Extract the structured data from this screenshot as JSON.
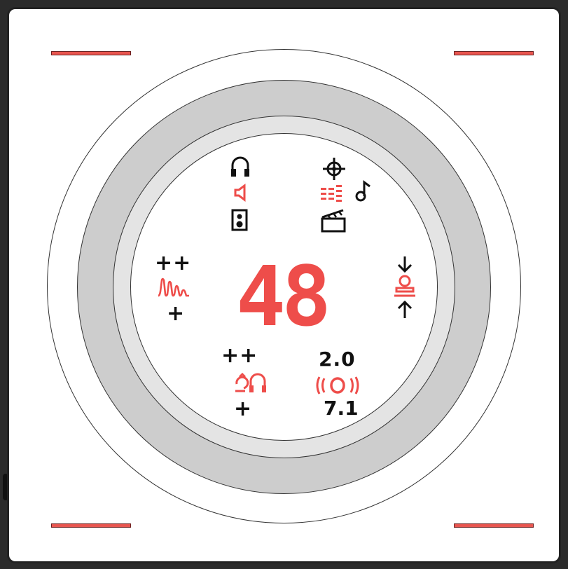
{
  "display": {
    "value": "48"
  },
  "controls": {
    "boost_top": "++",
    "boost_bottom": "+",
    "sidetone_top": "++",
    "sidetone_bottom": "+",
    "mode_top": "2.0",
    "mode_bottom": "7.1"
  },
  "colors": {
    "accent": "#ee4d4a",
    "ink": "#111111",
    "ring_outer": "#cdcdcd",
    "ring_inner": "#e2e2e2"
  },
  "icons": {
    "output_top": "headphones-icon",
    "output_mid": "speaker-icon",
    "output_bottom": "speaker-box-icon",
    "preset_top": "crosshair-icon",
    "preset_mid": "equalizer-icon",
    "preset_music": "music-note-icon",
    "preset_bottom": "clapperboard-icon",
    "eq_wave": "waveform-icon",
    "mic_monitor": "headset-sidetone-icon",
    "surround": "surround-icon",
    "mic_gain": "mic-gain-icon"
  }
}
